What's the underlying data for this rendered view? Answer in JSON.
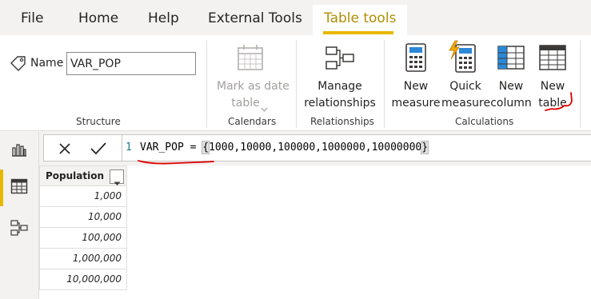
{
  "menu": {
    "tabs": [
      "File",
      "Home",
      "Help",
      "External Tools",
      "Table tools"
    ],
    "active_tab": "Table tools"
  },
  "ribbon": {
    "structure": {
      "name_label": "Name",
      "name_value": "VAR_POP",
      "group_label": "Structure"
    },
    "calendars": {
      "mark_date_line1": "Mark as date",
      "mark_date_line2": "table",
      "group_label": "Calendars"
    },
    "relationships": {
      "manage_line1": "Manage",
      "manage_line2": "relationships",
      "group_label": "Relationships"
    },
    "calculations": {
      "new_measure_line1": "New",
      "new_measure_line2": "measure",
      "quick_measure_line1": "Quick",
      "quick_measure_line2": "measure",
      "new_column_line1": "New",
      "new_column_line2": "column",
      "new_table_line1": "New",
      "new_table_line2": "table",
      "group_label": "Calculations"
    }
  },
  "formula_bar": {
    "line_number": "1",
    "table_name": "VAR_POP",
    "operator": " = ",
    "open_brace": "{",
    "values": "1000,10000,100000,1000000,10000000",
    "close_brace": "}"
  },
  "table": {
    "column_header": "Population",
    "rows": [
      "1,000",
      "10,000",
      "100,000",
      "1,000,000",
      "10,000,000"
    ]
  },
  "icons": [
    "tag-icon",
    "calendar-icon",
    "relationships-icon",
    "calculator-icon",
    "quick-measure-icon",
    "column-icon",
    "table-icon",
    "report-view-icon",
    "data-view-icon",
    "model-view-icon",
    "close-icon",
    "check-icon",
    "chevron-down-icon"
  ],
  "colors": {
    "accent": "#e8b800",
    "active_tab_text": "#b08d00",
    "annotation_red": "#e00000",
    "column_blue": "#2b88d8"
  }
}
